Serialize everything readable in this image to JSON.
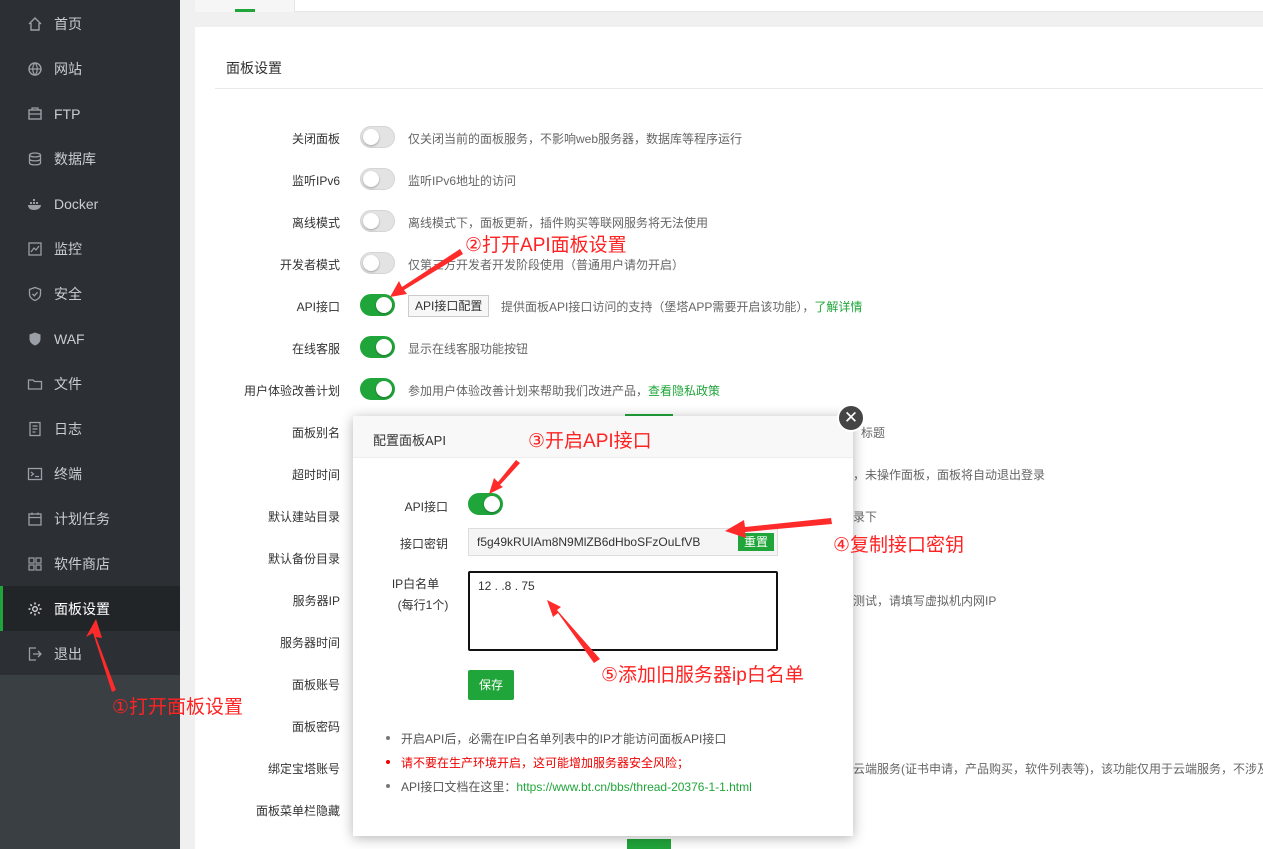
{
  "sidebar": {
    "items": [
      {
        "label": "首页",
        "icon": "home-icon"
      },
      {
        "label": "网站",
        "icon": "globe-icon"
      },
      {
        "label": "FTP",
        "icon": "ftp-icon"
      },
      {
        "label": "数据库",
        "icon": "database-icon"
      },
      {
        "label": "Docker",
        "icon": "docker-icon"
      },
      {
        "label": "监控",
        "icon": "monitor-icon"
      },
      {
        "label": "安全",
        "icon": "shield-icon"
      },
      {
        "label": "WAF",
        "icon": "waf-icon"
      },
      {
        "label": "文件",
        "icon": "folder-icon"
      },
      {
        "label": "日志",
        "icon": "log-icon"
      },
      {
        "label": "终端",
        "icon": "terminal-icon"
      },
      {
        "label": "计划任务",
        "icon": "calendar-icon"
      },
      {
        "label": "软件商店",
        "icon": "apps-icon"
      },
      {
        "label": "面板设置",
        "icon": "gear-icon",
        "active": true
      },
      {
        "label": "退出",
        "icon": "logout-icon"
      }
    ]
  },
  "panel": {
    "title": "面板设置",
    "rows": [
      {
        "label": "关闭面板",
        "toggle": "off",
        "desc": "仅关闭当前的面板服务，不影响web服务器，数据库等程序运行"
      },
      {
        "label": "监听IPv6",
        "toggle": "off",
        "desc": "监听IPv6地址的访问"
      },
      {
        "label": "离线模式",
        "toggle": "off",
        "desc": "离线模式下，面板更新，插件购买等联网服务将无法使用"
      },
      {
        "label": "开发者模式",
        "toggle": "off",
        "desc": "仅第三方开发者开发阶段使用（普通用户请勿开启）"
      },
      {
        "label": "API接口",
        "toggle": "on",
        "button": "API接口配置",
        "desc": "提供面板API接口访问的支持（堡塔APP需要开启该功能），",
        "link": "了解详情"
      },
      {
        "label": "在线客服",
        "toggle": "on",
        "desc": "显示在线客服功能按钮"
      },
      {
        "label": "用户体验改善计划",
        "toggle": "on",
        "desc": "参加用户体验改善计划来帮助我们改进产品，",
        "link": "查看隐私政策"
      },
      {
        "label": "面板别名",
        "desc": "标题"
      },
      {
        "label": "超时时间",
        "desc": "，未操作面板，面板将自动退出登录"
      },
      {
        "label": "默认建站目录",
        "desc": "录下"
      },
      {
        "label": "默认备份目录",
        "desc": ""
      },
      {
        "label": "服务器IP",
        "desc": "测试，请填写虚拟机内网IP"
      },
      {
        "label": "服务器时间",
        "desc": ""
      },
      {
        "label": "面板账号",
        "desc": ""
      },
      {
        "label": "面板密码",
        "desc": ""
      },
      {
        "label": "绑定宝塔账号",
        "desc": "云端服务(证书申请，产品购买，软件列表等)，该功能仅用于云端服务，不涉及"
      },
      {
        "label": "面板菜单栏隐藏",
        "desc": ""
      }
    ]
  },
  "modal": {
    "title": "配置面板API",
    "api_label": "API接口",
    "key_label": "接口密钥",
    "key_value": "f5g49kRUIAm8N9MlZB6dHboSFzOuLfVB",
    "reset_label": "重置",
    "ip_label": "IP白名单",
    "ip_sublabel": "(每行1个)",
    "ip_value": "12  .  .8  .  75",
    "save_label": "保存",
    "notes": [
      {
        "text": "开启API后，必需在IP白名单列表中的IP才能访问面板API接口",
        "red": false
      },
      {
        "text": "请不要在生产环境开启，这可能增加服务器安全风险；",
        "red": true
      },
      {
        "text": "API接口文档在这里：",
        "link": "https://www.bt.cn/bbs/thread-20376-1-1.html",
        "red": false
      }
    ]
  },
  "annotations": {
    "a1": "①打开面板设置",
    "a2": "②打开API面板设置",
    "a3": "③开启API接口",
    "a4": "④复制接口密钥",
    "a5": "⑤添加旧服务器ip白名单"
  },
  "colors": {
    "accent": "#20a53a",
    "annotation": "#ff2222",
    "sidebar": "#2c3035"
  }
}
